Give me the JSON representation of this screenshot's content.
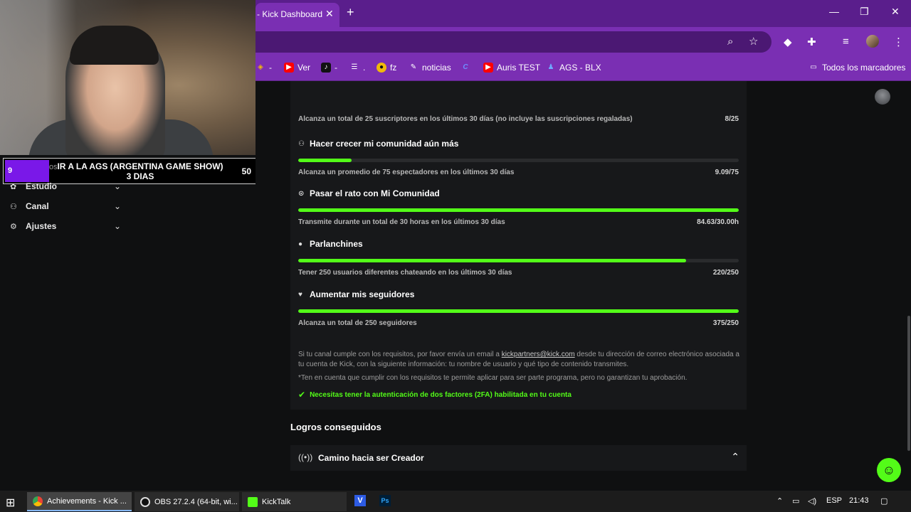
{
  "browser": {
    "tab_title": "- Kick Dashboard",
    "tab_close": "✕",
    "new_tab": "+",
    "window_controls": [
      "—",
      "❐",
      "✕"
    ],
    "bookmarks": [
      {
        "label": "-",
        "icon": "binance-icon",
        "color": "#f0b90b"
      },
      {
        "label": "Ver",
        "icon": "youtube-icon",
        "color": "#ff0000"
      },
      {
        "label": "-",
        "icon": "tiktok-icon",
        "color": "#000000"
      },
      {
        "label": ".",
        "icon": "stack-icon",
        "color": "#7a2fb3"
      },
      {
        "label": "fz",
        "icon": "emblem-icon",
        "color": "#f0b90b"
      },
      {
        "label": "noticias",
        "icon": "pencil-icon",
        "color": "#ffffff"
      },
      {
        "label": "",
        "icon": "cs-icon",
        "color": "#4c6fff"
      },
      {
        "label": "Auris TEST",
        "icon": "youtube-icon",
        "color": "#ff0000"
      },
      {
        "label": "AGS - BLX",
        "icon": "person-icon",
        "color": "#3b82f6"
      }
    ],
    "all_bookmarks": "Todos los marcadores"
  },
  "alert": {
    "number": "9",
    "fragment": "os",
    "text": "IR A LA AGS (ARGENTINA GAME SHOW) 3 DIAS",
    "count": "50"
  },
  "sidebar": {
    "items": [
      {
        "label": "Estudio"
      },
      {
        "label": "Canal"
      },
      {
        "label": "Ajustes"
      }
    ]
  },
  "requirements": [
    {
      "title": "",
      "desc": "Alcanza un total de 25 suscriptores en los últimos 30 días (no incluye las suscripciones regaladas)",
      "value": "8/25",
      "progress": null,
      "icon": ""
    },
    {
      "title": "Hacer crecer mi comunidad aún más",
      "desc": "Alcanza un promedio de 75 espectadores en los últimos 30 días",
      "value": "9.09/75",
      "progress": 0.121,
      "icon": "community-icon"
    },
    {
      "title": "Pasar el rato con Mi Comunidad",
      "desc": "Transmite durante un total de 30 horas en los últimos 30 días",
      "value": "84.63/30.00h",
      "progress": 1.0,
      "icon": "broadcast-icon"
    },
    {
      "title": "Parlanchines",
      "desc": "Tener 250 usuarios diferentes chateando en los últimos 30 días",
      "value": "220/250",
      "progress": 0.88,
      "icon": "chat-icon"
    },
    {
      "title": "Aumentar mis seguidores",
      "desc": "Alcanza un total de 250 seguidores",
      "value": "375/250",
      "progress": 1.0,
      "icon": "heart-icon"
    }
  ],
  "note": {
    "pre": "Si tu canal cumple con los requisitos, por favor envía un email a ",
    "email": "kickpartners@kick.com",
    "post": " desde tu dirección de correo electrónico asociada a tu cuenta de Kick, con la siguiente información: tu nombre de usuario y qué tipo de contenido transmites.",
    "disclaimer": "*Ten en cuenta que cumplir con los requisitos te permite aplicar para ser parte programa, pero no garantizan tu aprobación.",
    "twofa": "Necesitas tener la autenticación de dos factores (2FA) habilitada en tu cuenta"
  },
  "achievements": {
    "section_title": "Logros conseguidos",
    "accordion_label": "Camino hacia ser Creador"
  },
  "taskbar": {
    "items": [
      {
        "label": "Achievements - Kick ...",
        "color": "#ea4335"
      },
      {
        "label": "OBS 27.2.4 (64-bit, wi...",
        "color": "#ffffff"
      },
      {
        "label": "KickTalk",
        "color": "#53fc18"
      }
    ],
    "lang": "ESP",
    "time": "21:43"
  },
  "colors": {
    "accent": "#53fc18",
    "browser": "#7a2fb3"
  }
}
